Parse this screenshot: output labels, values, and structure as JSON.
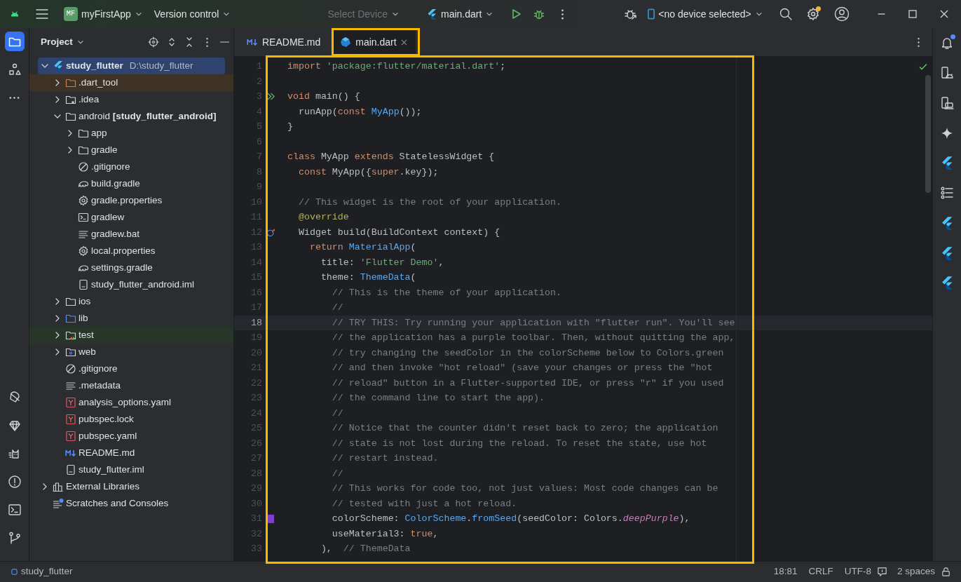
{
  "title_bar": {
    "project_badge": "MF",
    "project": "myFirstApp",
    "vcs": "Version control",
    "device_placeholder": "Select Device",
    "device_placeholder_disabled": true,
    "run_config": "main.dart",
    "device_selector": "<no device selected>",
    "settings_badge": true
  },
  "left_strip": {
    "top": [
      {
        "kind": "project",
        "selected": true
      },
      {
        "kind": "structure",
        "selected": false
      },
      {
        "kind": "more",
        "selected": false
      }
    ],
    "bottom": [
      {
        "kind": "paint",
        "selected": false
      },
      {
        "kind": "gem",
        "selected": false
      },
      {
        "kind": "cat",
        "selected": false
      },
      {
        "kind": "problems",
        "selected": false
      },
      {
        "kind": "terminal",
        "selected": false
      },
      {
        "kind": "git",
        "selected": false
      }
    ]
  },
  "project_panel": {
    "title": "Project",
    "tree": [
      {
        "label": "study_flutter",
        "path": "D:\\study_flutter",
        "kind": "flutter",
        "selected": true,
        "expanded": true,
        "children": [
          {
            "label": ".dart_tool",
            "kind": "folder-excluded",
            "selected": false,
            "expanded": false,
            "color": "#3d3223"
          },
          {
            "label": ".idea",
            "kind": "folder-idea",
            "selected": false,
            "expanded": false
          },
          {
            "label": "android **[study_flutter_android]**",
            "kind": "folder",
            "selected": false,
            "expanded": true,
            "children": [
              {
                "label": "app",
                "kind": "folder",
                "selected": false,
                "expanded": false
              },
              {
                "label": "gradle",
                "kind": "folder",
                "selected": false,
                "expanded": false
              },
              {
                "label": ".gitignore",
                "kind": "ignore",
                "selected": false
              },
              {
                "label": "build.gradle",
                "kind": "gradle",
                "selected": false
              },
              {
                "label": "gradle.properties",
                "kind": "gear",
                "selected": false
              },
              {
                "label": "gradlew",
                "kind": "terminal",
                "selected": false
              },
              {
                "label": "gradlew.bat",
                "kind": "lines",
                "selected": false
              },
              {
                "label": "local.properties",
                "kind": "gear",
                "selected": false
              },
              {
                "label": "settings.gradle",
                "kind": "gradle",
                "selected": false
              },
              {
                "label": "study_flutter_android.iml",
                "kind": "iml",
                "selected": false
              }
            ]
          },
          {
            "label": "ios",
            "kind": "folder",
            "selected": false,
            "expanded": false
          },
          {
            "label": "lib",
            "kind": "folder-source",
            "selected": false,
            "expanded": false
          },
          {
            "label": "test",
            "kind": "folder-test",
            "selected": false,
            "expanded": false,
            "color": "#283529"
          },
          {
            "label": "web",
            "kind": "folder-web",
            "selected": false,
            "expanded": false
          },
          {
            "label": ".gitignore",
            "kind": "ignore",
            "selected": false
          },
          {
            "label": ".metadata",
            "kind": "lines",
            "selected": false
          },
          {
            "label": "analysis_options.yaml",
            "kind": "yaml",
            "selected": false
          },
          {
            "label": "pubspec.lock",
            "kind": "yaml",
            "selected": false
          },
          {
            "label": "pubspec.yaml",
            "kind": "yaml",
            "selected": false
          },
          {
            "label": "README.md",
            "kind": "md",
            "selected": false
          },
          {
            "label": "study_flutter.iml",
            "kind": "iml",
            "selected": false
          }
        ]
      },
      {
        "label": "External Libraries",
        "kind": "library",
        "selected": false,
        "expanded": false
      },
      {
        "label": "Scratches and Consoles",
        "kind": "scratch",
        "selected": false
      }
    ]
  },
  "editor": {
    "tabs": [
      {
        "label": "README.md",
        "kind": "md",
        "selected": false,
        "closable": false
      },
      {
        "label": "main.dart",
        "kind": "dart",
        "selected": true,
        "closable": true
      }
    ],
    "lines": [
      {
        "number": "1",
        "current": false,
        "tokens": [
          {
            "kind": "kw",
            "text": "import "
          },
          {
            "kind": "str",
            "text": "'package:flutter/material.dart'"
          },
          {
            "kind": "plain",
            "text": ";"
          }
        ]
      },
      {
        "number": "2",
        "current": false
      },
      {
        "number": "3",
        "current": false,
        "gutter": {
          "kind": "run"
        },
        "tokens": [
          {
            "kind": "kw",
            "text": "void"
          },
          {
            "kind": "plain",
            "text": " main() {"
          }
        ]
      },
      {
        "number": "4",
        "current": false,
        "tokens": [
          {
            "kind": "plain",
            "text": "  runApp("
          },
          {
            "kind": "kw",
            "text": "const"
          },
          {
            "kind": "cls",
            "text": " MyApp"
          },
          {
            "kind": "plain",
            "text": "());"
          }
        ]
      },
      {
        "number": "5",
        "current": false,
        "tokens": [
          {
            "kind": "plain",
            "text": "}"
          }
        ]
      },
      {
        "number": "6",
        "current": false
      },
      {
        "number": "7",
        "current": false,
        "tokens": [
          {
            "kind": "kw",
            "text": "class"
          },
          {
            "kind": "plain",
            "text": " MyApp "
          },
          {
            "kind": "kw",
            "text": "extends"
          },
          {
            "kind": "plain",
            "text": " StatelessWidget {"
          }
        ]
      },
      {
        "number": "8",
        "current": false,
        "tokens": [
          {
            "kind": "kw",
            "text": "  const"
          },
          {
            "kind": "plain",
            "text": " MyApp({"
          },
          {
            "kind": "kw",
            "text": "super"
          },
          {
            "kind": "plain",
            "text": ".key});"
          }
        ]
      },
      {
        "number": "9",
        "current": false
      },
      {
        "number": "10",
        "current": false,
        "tokens": [
          {
            "kind": "com",
            "text": "  // This widget is the root of your application."
          }
        ]
      },
      {
        "number": "11",
        "current": false,
        "tokens": [
          {
            "kind": "ann",
            "text": "  @override"
          }
        ]
      },
      {
        "number": "12",
        "current": false,
        "gutter": {
          "kind": "override"
        },
        "tokens": [
          {
            "kind": "plain",
            "text": "  Widget build(BuildContext context) {"
          }
        ]
      },
      {
        "number": "13",
        "current": false,
        "tokens": [
          {
            "kind": "kw",
            "text": "    return"
          },
          {
            "kind": "cls",
            "text": " MaterialApp"
          },
          {
            "kind": "plain",
            "text": "("
          }
        ]
      },
      {
        "number": "14",
        "current": false,
        "tokens": [
          {
            "kind": "plain",
            "text": "      title: "
          },
          {
            "kind": "str",
            "text": "'Flutter Demo'"
          },
          {
            "kind": "plain",
            "text": ","
          }
        ]
      },
      {
        "number": "15",
        "current": false,
        "tokens": [
          {
            "kind": "plain",
            "text": "      theme: "
          },
          {
            "kind": "cls",
            "text": "ThemeData"
          },
          {
            "kind": "plain",
            "text": "("
          }
        ]
      },
      {
        "number": "16",
        "current": false,
        "tokens": [
          {
            "kind": "com",
            "text": "        // This is the theme of your application."
          }
        ]
      },
      {
        "number": "17",
        "current": false,
        "tokens": [
          {
            "kind": "com",
            "text": "        //"
          }
        ]
      },
      {
        "number": "18",
        "current": true,
        "tokens": [
          {
            "kind": "com",
            "text": "        // TRY THIS: Try running your application with \"flutter run\". You'll see"
          }
        ]
      },
      {
        "number": "19",
        "current": false,
        "tokens": [
          {
            "kind": "com",
            "text": "        // the application has a purple toolbar. Then, without quitting the app,"
          }
        ]
      },
      {
        "number": "20",
        "current": false,
        "tokens": [
          {
            "kind": "com",
            "text": "        // try changing the seedColor in the colorScheme below to Colors.green"
          }
        ]
      },
      {
        "number": "21",
        "current": false,
        "tokens": [
          {
            "kind": "com",
            "text": "        // and then invoke \"hot reload\" (save your changes or press the \"hot"
          }
        ]
      },
      {
        "number": "22",
        "current": false,
        "tokens": [
          {
            "kind": "com",
            "text": "        // reload\" button in a Flutter-supported IDE, or press \"r\" if you used"
          }
        ]
      },
      {
        "number": "23",
        "current": false,
        "tokens": [
          {
            "kind": "com",
            "text": "        // the command line to start the app)."
          }
        ]
      },
      {
        "number": "24",
        "current": false,
        "tokens": [
          {
            "kind": "com",
            "text": "        //"
          }
        ]
      },
      {
        "number": "25",
        "current": false,
        "tokens": [
          {
            "kind": "com",
            "text": "        // Notice that the counter didn't reset back to zero; the application"
          }
        ]
      },
      {
        "number": "26",
        "current": false,
        "tokens": [
          {
            "kind": "com",
            "text": "        // state is not lost during the reload. To reset the state, use hot"
          }
        ]
      },
      {
        "number": "27",
        "current": false,
        "tokens": [
          {
            "kind": "com",
            "text": "        // restart instead."
          }
        ]
      },
      {
        "number": "28",
        "current": false,
        "tokens": [
          {
            "kind": "com",
            "text": "        //"
          }
        ]
      },
      {
        "number": "29",
        "current": false,
        "tokens": [
          {
            "kind": "com",
            "text": "        // This works for code too, not just values: Most code changes can be"
          }
        ]
      },
      {
        "number": "30",
        "current": false,
        "tokens": [
          {
            "kind": "com",
            "text": "        // tested with just a hot reload."
          }
        ]
      },
      {
        "number": "31",
        "current": false,
        "gutter": {
          "kind": "swatch",
          "color": "#7e3fcf"
        },
        "tokens": [
          {
            "kind": "plain",
            "text": "        colorScheme: "
          },
          {
            "kind": "cls",
            "text": "ColorScheme"
          },
          {
            "kind": "plain",
            "text": "."
          },
          {
            "kind": "fn",
            "text": "fromSeed"
          },
          {
            "kind": "plain",
            "text": "(seedColor: Colors."
          },
          {
            "kind": "ital",
            "text": "deepPurple"
          },
          {
            "kind": "plain",
            "text": "),"
          }
        ]
      },
      {
        "number": "32",
        "current": false,
        "tokens": [
          {
            "kind": "plain",
            "text": "        useMaterial3: "
          },
          {
            "kind": "kw",
            "text": "true"
          },
          {
            "kind": "plain",
            "text": ","
          }
        ]
      },
      {
        "number": "33",
        "current": false,
        "tokens": [
          {
            "kind": "plain",
            "text": "      ),  "
          },
          {
            "kind": "com",
            "text": "// ThemeData"
          }
        ]
      }
    ]
  },
  "right_strip": [
    {
      "kind": "bell",
      "badge": true
    },
    {
      "kind": "device-android",
      "badge": false
    },
    {
      "kind": "device-mirror",
      "badge": false
    },
    {
      "kind": "sparkle",
      "badge": false
    },
    {
      "kind": "flutter",
      "badge": false
    },
    {
      "kind": "list",
      "badge": false
    },
    {
      "kind": "flutter",
      "badge": false
    },
    {
      "kind": "flutter",
      "badge": false
    },
    {
      "kind": "flutter",
      "badge": false
    }
  ],
  "status_bar": {
    "breadcrumb": "study_flutter",
    "position": "18:81",
    "line_separator": "CRLF",
    "encoding": "UTF-8",
    "indent": "2 spaces"
  }
}
